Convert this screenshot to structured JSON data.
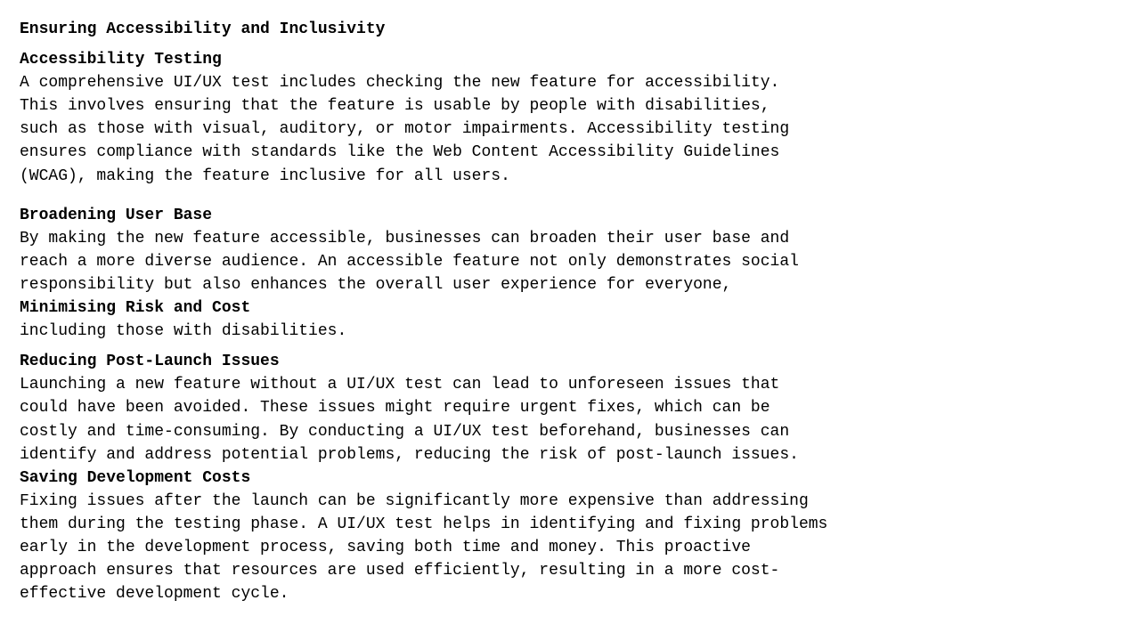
{
  "section1": {
    "heading": "Ensuring Accessibility and Inclusivity",
    "subheading": "Accessibility Testing",
    "body": "A comprehensive UI/UX test includes checking the new feature for accessibility.\nThis involves ensuring that the feature is usable by people with disabilities,\nsuch as those with visual, auditory, or motor impairments. Accessibility testing\nensures compliance with standards like the Web Content Accessibility Guidelines\n(WCAG), making the feature inclusive for all users."
  },
  "section2": {
    "heading": "Broadening User Base",
    "body": "By making the new feature accessible, businesses can broaden their user base and\nreach a more diverse audience. An accessible feature not only demonstrates social\nresponsibility but also enhances the overall user experience for everyone,",
    "body_overlap_line1": "Minimising Risk and Cost",
    "body_overlap_line2": "including those with disabilities.",
    "subheading": "Reducing Post-Launch Issues",
    "body2": "Launching a new feature without a UI/UX test can lead to unforeseen issues that\ncould have been avoided. These issues might require urgent fixes, which can be\ncostly and time-consuming. By conducting a UI/UX test beforehand, businesses can\nidentify and address potential problems, reducing the risk of post-launch issues."
  },
  "section3": {
    "heading": "Saving Development Costs",
    "body": "Fixing issues after the launch can be significantly more expensive than addressing\nthem during the testing phase. A UI/UX test helps in identifying and fixing problems\nearly in the development process, saving both time and money. This proactive\napproach ensures that resources are used efficiently, resulting in a more cost-\neffective development cycle."
  }
}
